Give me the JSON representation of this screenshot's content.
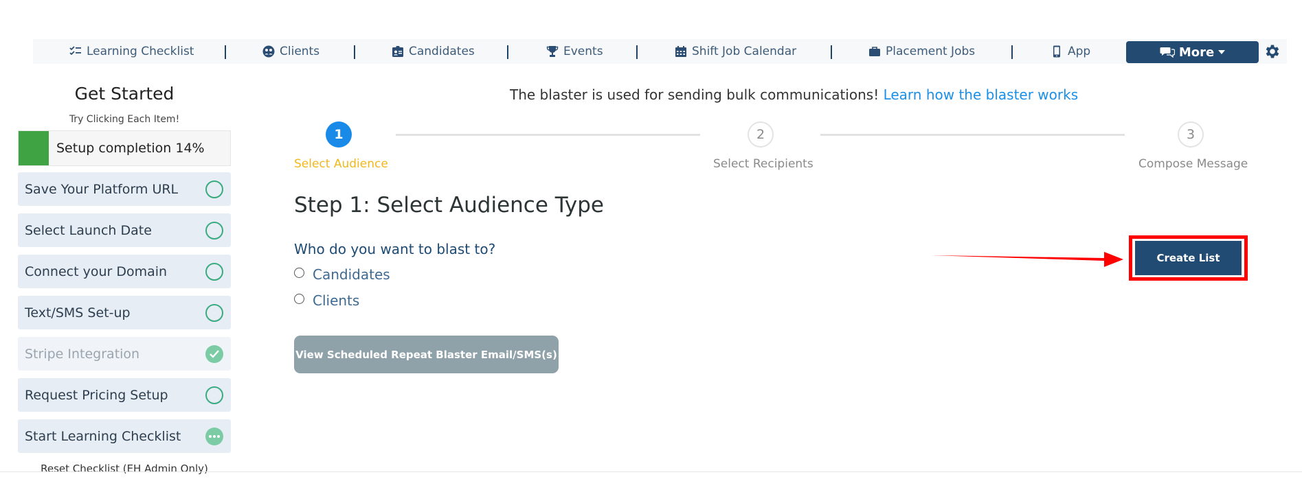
{
  "nav": {
    "items": [
      {
        "label": "Learning Checklist",
        "icon": "checklist-icon"
      },
      {
        "label": "Clients",
        "icon": "clients-icon"
      },
      {
        "label": "Candidates",
        "icon": "id-badge-icon"
      },
      {
        "label": "Events",
        "icon": "trophy-icon"
      },
      {
        "label": "Shift Job Calendar",
        "icon": "calendar-icon"
      },
      {
        "label": "Placement Jobs",
        "icon": "briefcase-icon"
      },
      {
        "label": "App",
        "icon": "mobile-icon"
      }
    ],
    "more_label": "More",
    "settings_icon": "gear-icon"
  },
  "sidebar": {
    "title": "Get Started",
    "subtitle": "Try Clicking Each Item!",
    "progress_text": "Setup completion 14%",
    "progress_percent": 14,
    "progress_color": "#3fa343",
    "items": [
      {
        "label": "Save Your Platform URL",
        "status": "pending"
      },
      {
        "label": "Select Launch Date",
        "status": "pending"
      },
      {
        "label": "Connect your Domain",
        "status": "pending"
      },
      {
        "label": "Text/SMS Set-up",
        "status": "pending"
      },
      {
        "label": "Stripe Integration",
        "status": "done"
      },
      {
        "label": "Request Pricing Setup",
        "status": "pending"
      },
      {
        "label": "Start Learning Checklist",
        "status": "in-progress"
      }
    ],
    "reset_label": "Reset Checklist (EH Admin Only)"
  },
  "main": {
    "intro_text": "The blaster is used for sending bulk communications!",
    "intro_link": "Learn how the blaster works",
    "steps": [
      {
        "number": "1",
        "label": "Select Audience",
        "active": true
      },
      {
        "number": "2",
        "label": "Select Recipients",
        "active": false
      },
      {
        "number": "3",
        "label": "Compose Message",
        "active": false
      }
    ],
    "heading": "Step 1: Select Audience Type",
    "question": "Who do you want to blast to?",
    "options": [
      "Candidates",
      "Clients"
    ],
    "view_button": "View Scheduled Repeat Blaster Email/SMS(s)",
    "create_button": "Create List"
  },
  "colors": {
    "accent": "#234b72",
    "link": "#1a8fe8",
    "active_step": "#1a8ae8",
    "active_step_label": "#f2b81a",
    "highlight": "#ff0000"
  }
}
